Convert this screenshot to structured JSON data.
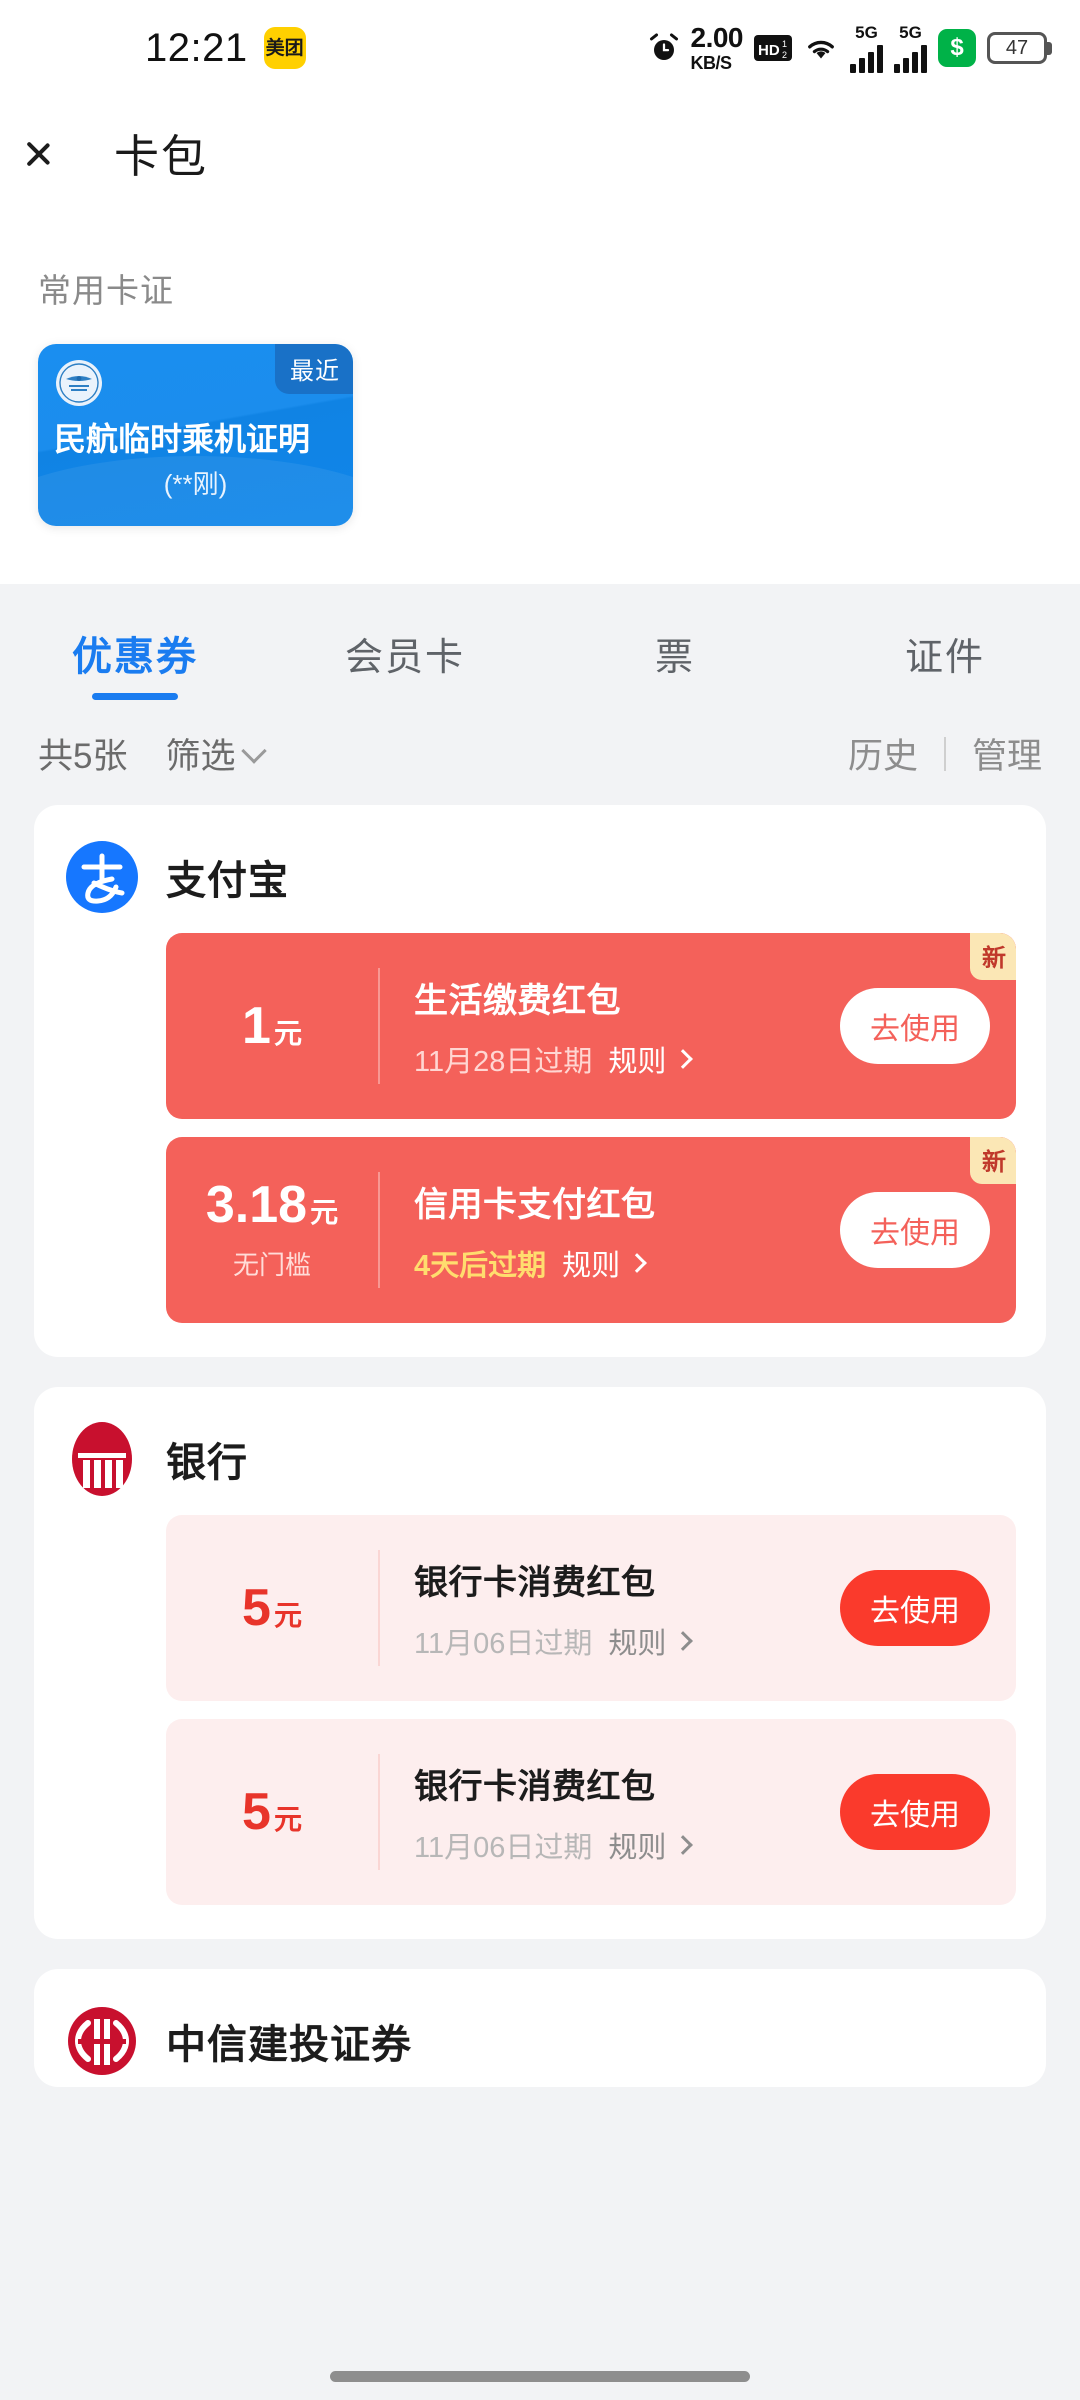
{
  "status_bar": {
    "time": "12:21",
    "app_badge": "美团",
    "alarm_icon": "alarm-icon",
    "network_speed_value": "2.00",
    "network_speed_unit": "KB/S",
    "hd_icon": "hd-volte-icon",
    "wifi_icon": "wifi-icon",
    "signal_1_label": "5G",
    "signal_2_label": "5G",
    "shield_icon": "security-shield-icon",
    "battery_level": "47"
  },
  "nav": {
    "back_icon": "back-chevron-icon",
    "title": "卡包"
  },
  "frequent": {
    "section_title": "常用卡证",
    "card": {
      "badge": "最近",
      "logo_icon": "civil-aviation-emblem-icon",
      "name": "民航临时乘机证明",
      "subtitle": "(**刚)"
    }
  },
  "tabs": [
    {
      "label": "优惠券",
      "active": true
    },
    {
      "label": "会员卡",
      "active": false
    },
    {
      "label": "票",
      "active": false
    },
    {
      "label": "证件",
      "active": false
    }
  ],
  "filter_bar": {
    "count_text": "共5张",
    "filter_label": "筛选",
    "filter_chevron_icon": "chevron-down-icon",
    "history_label": "历史",
    "manage_label": "管理"
  },
  "merchants": [
    {
      "name": "支付宝",
      "logo_icon": "alipay-logo-icon",
      "style": "red",
      "coupons": [
        {
          "amount": "1",
          "unit": "元",
          "condition": "",
          "title": "生活缴费红包",
          "expiry": "11月28日过期",
          "expiry_warn": false,
          "rule_label": "规则",
          "rule_chevron_icon": "chevron-right-icon",
          "button_label": "去使用",
          "new_badge": "新"
        },
        {
          "amount": "3.18",
          "unit": "元",
          "condition": "无门槛",
          "title": "信用卡支付红包",
          "expiry": "4天后过期",
          "expiry_warn": true,
          "rule_label": "规则",
          "rule_chevron_icon": "chevron-right-icon",
          "button_label": "去使用",
          "new_badge": "新"
        }
      ]
    },
    {
      "name": "银行",
      "logo_icon": "bank-building-icon",
      "style": "pink",
      "coupons": [
        {
          "amount": "5",
          "unit": "元",
          "condition": "",
          "title": "银行卡消费红包",
          "expiry": "11月06日过期",
          "expiry_warn": false,
          "rule_label": "规则",
          "rule_chevron_icon": "chevron-right-icon",
          "button_label": "去使用",
          "new_badge": ""
        },
        {
          "amount": "5",
          "unit": "元",
          "condition": "",
          "title": "银行卡消费红包",
          "expiry": "11月06日过期",
          "expiry_warn": false,
          "rule_label": "规则",
          "rule_chevron_icon": "chevron-right-icon",
          "button_label": "去使用",
          "new_badge": ""
        }
      ]
    },
    {
      "name": "中信建投证券",
      "logo_icon": "citic-securities-logo-icon",
      "style": "pink",
      "coupons": []
    }
  ],
  "colors": {
    "accent_blue": "#1a7cf0",
    "coupon_red": "#f4615a",
    "coupon_pink_bg": "#fdeeee",
    "coupon_pink_text": "#e8342a",
    "page_bg": "#f2f3f5"
  }
}
